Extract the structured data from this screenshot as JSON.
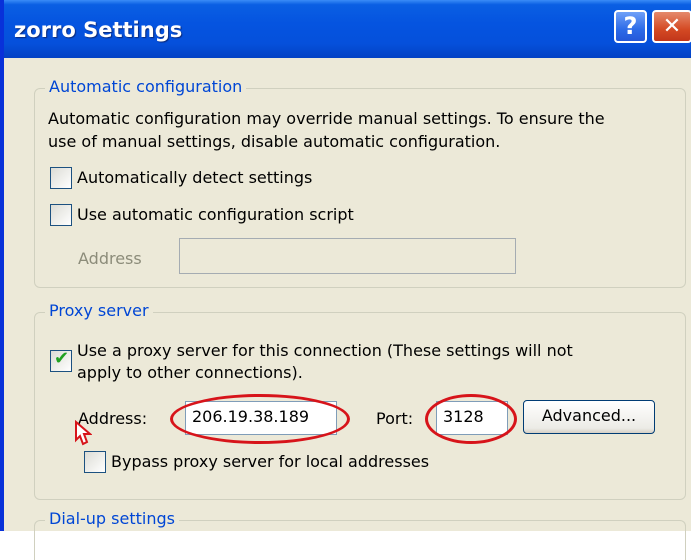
{
  "window": {
    "title": "zorro Settings",
    "help_label": "?",
    "close_label": "✕"
  },
  "auto_config": {
    "legend": "Automatic configuration",
    "description_line1": "Automatic configuration may override manual settings.  To ensure the",
    "description_line2": "use of manual settings, disable automatic configuration.",
    "detect_label": "Automatically detect settings",
    "detect_checked": false,
    "script_label": "Use automatic configuration script",
    "script_checked": false,
    "address_label": "Address",
    "address_value": ""
  },
  "proxy": {
    "legend": "Proxy server",
    "use_proxy_line1": "Use a proxy server for this connection (These settings will not",
    "use_proxy_line2": "apply to other connections).",
    "use_proxy_checked": true,
    "address_label": "Address:",
    "address_value": "206.19.38.189",
    "port_label": "Port:",
    "port_value": "3128",
    "advanced_label": "Advanced...",
    "bypass_label": "Bypass proxy server for local addresses",
    "bypass_checked": false
  },
  "dialup": {
    "legend": "Dial-up settings"
  },
  "colors": {
    "highlight": "#d7141a",
    "legend_text": "#0046d5",
    "check": "#21a121"
  }
}
